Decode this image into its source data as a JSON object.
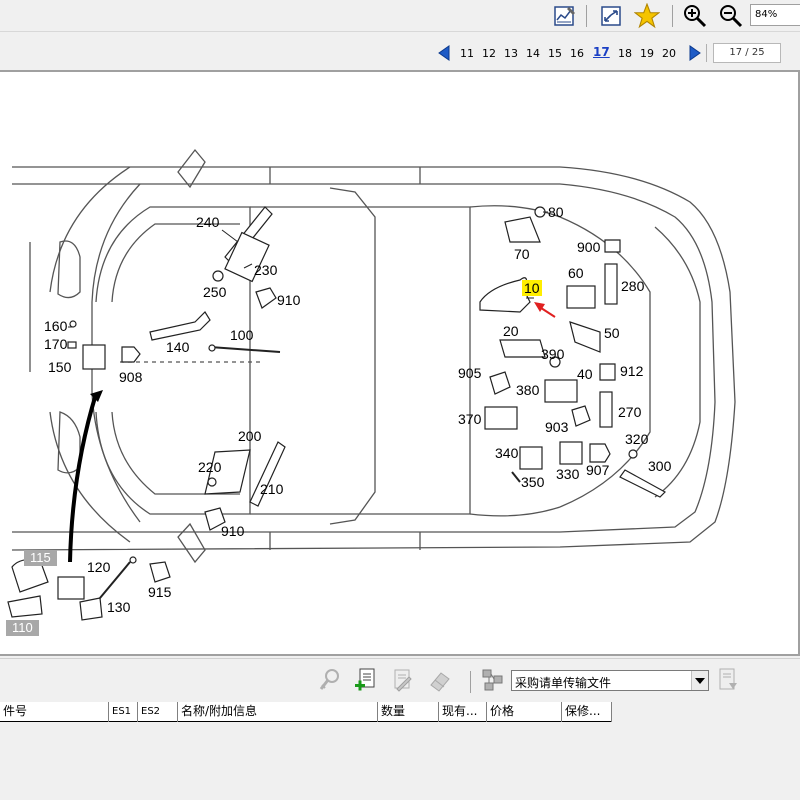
{
  "toolbar": {
    "zoom_value": "84%",
    "icons": [
      "chart-edit-icon",
      "fit-page-icon",
      "star-icon",
      "zoom-in-icon",
      "zoom-out-icon"
    ]
  },
  "pagination": {
    "pages": [
      "11",
      "12",
      "13",
      "14",
      "15",
      "16",
      "17",
      "18",
      "19",
      "20"
    ],
    "current": "17",
    "counter": "17 / 25"
  },
  "diagram": {
    "callouts": [
      "80",
      "70",
      "240",
      "230",
      "250",
      "910",
      "900",
      "60",
      "280",
      "10",
      "20",
      "50",
      "160",
      "170",
      "150",
      "908",
      "140",
      "100",
      "390",
      "905",
      "40",
      "912",
      "380",
      "370",
      "903",
      "270",
      "200",
      "220",
      "210",
      "910",
      "340",
      "330",
      "907",
      "320",
      "350",
      "300",
      "115",
      "120",
      "915",
      "130",
      "110"
    ],
    "highlighted_callout": "10",
    "accent_color": "#ffee00",
    "arrow_color": "#e02020"
  },
  "bottom_toolbar": {
    "select_value": "采购请单传输文件",
    "icons": [
      "search-key-icon",
      "add-document-icon",
      "document-edit-icon",
      "eraser-icon",
      "network-icon",
      "export-icon"
    ]
  },
  "table": {
    "columns": [
      "件号",
      "ES1",
      "ES2",
      "名称/附加信息",
      "数量",
      "现有...",
      "价格",
      "保修..."
    ]
  }
}
